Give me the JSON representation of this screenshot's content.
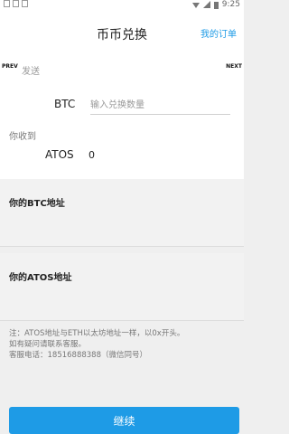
{
  "status_bar": {
    "time": "9:25"
  },
  "header": {
    "title": "币币兑换",
    "my_orders": "我的订单"
  },
  "carousel": {
    "prev": "PREV",
    "next": "NEXT"
  },
  "send": {
    "label": "发送",
    "currency": "BTC",
    "placeholder": "输入兑换数量",
    "value": ""
  },
  "receive": {
    "label": "你收到",
    "currency": "ATOS",
    "amount": "0"
  },
  "btc_address": {
    "label": "你的BTC地址",
    "value": ""
  },
  "atos_address": {
    "label": "你的ATOS地址",
    "value": ""
  },
  "notes": [
    "注：ATOS地址与ETH以太坊地址一样，以0x开头。",
    "如有疑问请联系客服。",
    "客服电话：18516888388（微信同号）"
  ],
  "continue_label": "继续",
  "colors": {
    "accent": "#1e9be6"
  }
}
